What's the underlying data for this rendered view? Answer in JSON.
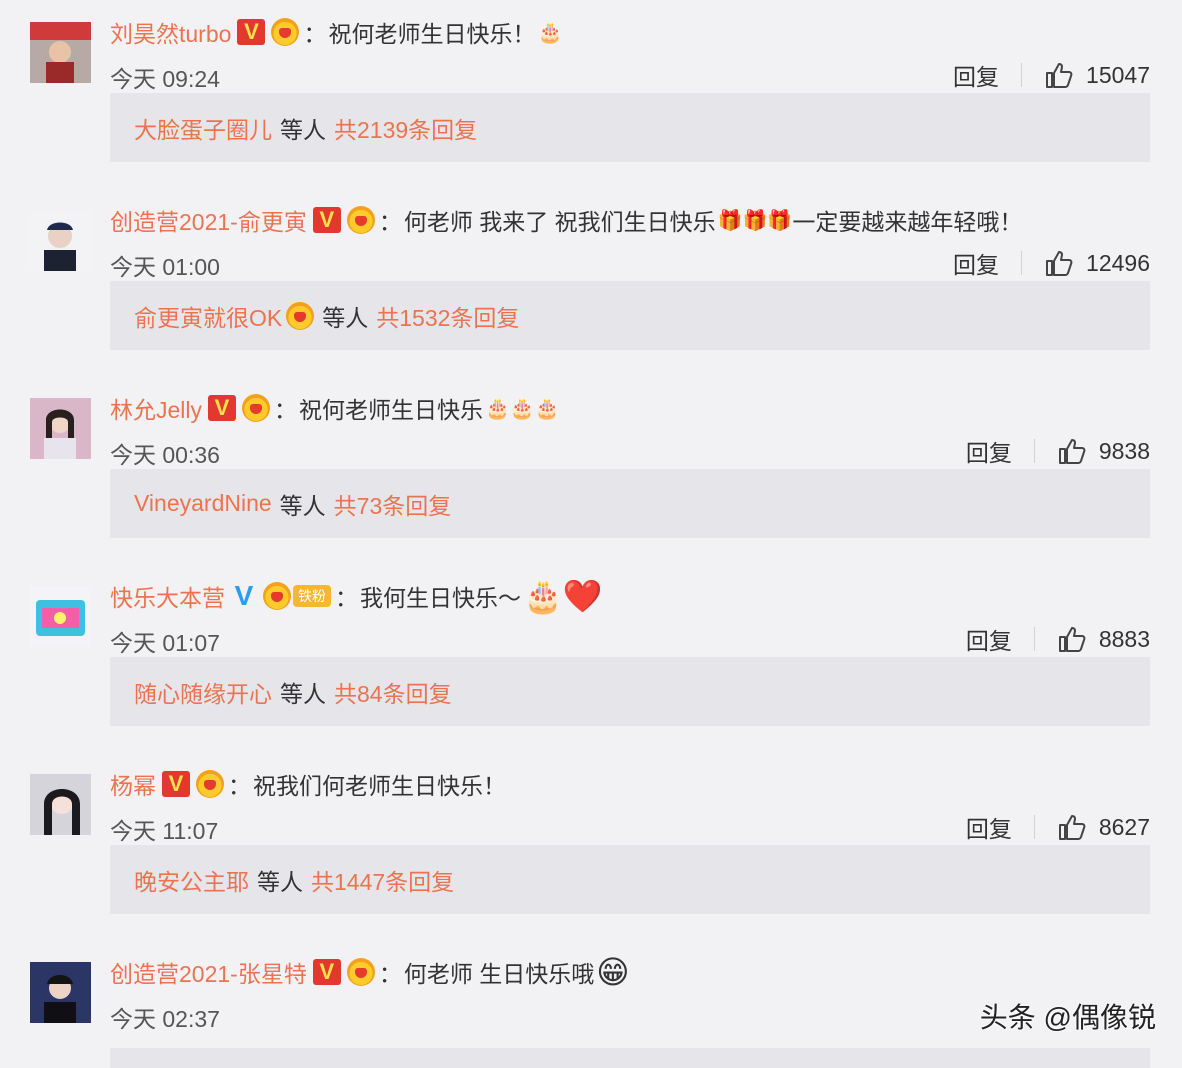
{
  "watermark": "头条 @偶像锐",
  "separator": "：",
  "reply_label": "回复",
  "subreply_deng": "等人",
  "comments": [
    {
      "username": "刘昊然turbo",
      "verified": "V",
      "verified_color": "#e3382f",
      "text": "祝何老师生日快乐！",
      "emoji": "🎂",
      "time": "今天 09:24",
      "likes": "15047",
      "sub_name": "大脸蛋子圈儿",
      "sub_total": "共2139条回复"
    },
    {
      "username": "创造营2021-俞更寅",
      "verified": "V",
      "verified_color": "#e3382f",
      "text": "何老师 我来了 祝我们生日快乐",
      "emoji": "🎁🎁🎁",
      "text_after": " 一定要越来越年轻哦！",
      "time": "今天 01:00",
      "likes": "12496",
      "sub_name": "俞更寅就很OK",
      "sub_total": "共1532条回复"
    },
    {
      "username": "林允Jelly",
      "verified": "V",
      "verified_color": "#e3382f",
      "text": "祝何老师生日快乐",
      "emoji": "🎂🎂🎂",
      "time": "今天 00:36",
      "likes": "9838",
      "sub_name": "VineyardNine",
      "sub_total": "共73条回复"
    },
    {
      "username": "快乐大本营",
      "verified": "V",
      "verified_color": "#2d9cec",
      "fan_badge": "铁粉",
      "text": "我何生日快乐～",
      "emoji": "🎂❤️",
      "time": "今天 01:07",
      "likes": "8883",
      "sub_name": "随心随缘开心",
      "sub_total": "共84条回复"
    },
    {
      "username": "杨幂",
      "verified": "V",
      "verified_color": "#e3382f",
      "text": "祝我们何老师生日快乐！",
      "emoji": "",
      "time": "今天 11:07",
      "likes": "8627",
      "sub_name": "晚安公主耶",
      "sub_total": "共1447条回复"
    },
    {
      "username": "创造营2021-张星特",
      "verified": "V",
      "verified_color": "#e3382f",
      "text": "何老师 生日快乐哦",
      "emoji": "😁",
      "time": "今天 02:37",
      "likes": "",
      "sub_name": "",
      "sub_total": ""
    }
  ]
}
